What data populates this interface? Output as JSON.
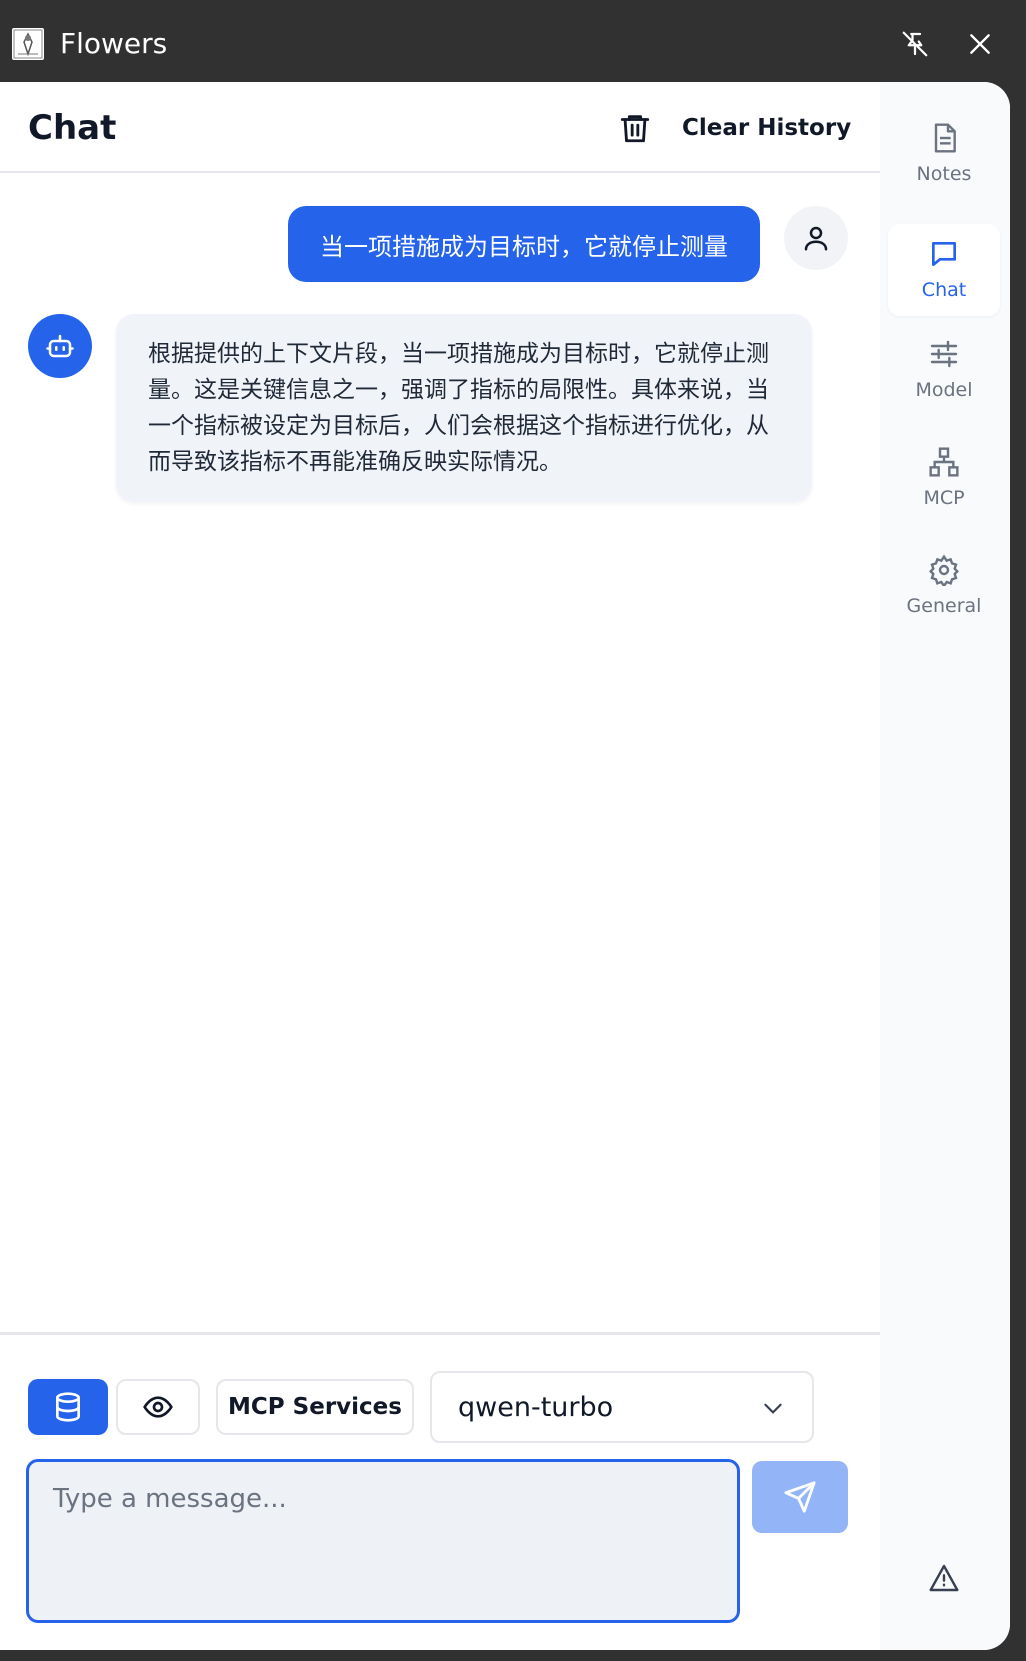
{
  "window": {
    "title": "Flowers"
  },
  "titlebar": {
    "icons": [
      "app-icon",
      "unpin-icon",
      "close-icon"
    ]
  },
  "chat": {
    "title": "Chat",
    "clear_label": "Clear History",
    "messages": [
      {
        "role": "user",
        "text": "当一项措施成为目标时，它就停止测量"
      },
      {
        "role": "assistant",
        "text": "根据提供的上下文片段，当一项措施成为目标时，它就停止测量。这是关键信息之一，强调了指标的局限性。具体来说，当一个指标被设定为目标后，人们会根据这个指标进行优化，从而导致该指标不再能准确反映实际情况。"
      }
    ]
  },
  "input": {
    "mcp_label": "MCP Services",
    "model": "qwen-turbo",
    "placeholder": "Type a message...",
    "value": ""
  },
  "sidebar": {
    "items": [
      {
        "label": "Notes",
        "icon": "notes-icon"
      },
      {
        "label": "Chat",
        "icon": "chat-icon",
        "active": true
      },
      {
        "label": "Model",
        "icon": "sliders-icon"
      },
      {
        "label": "MCP",
        "icon": "network-icon"
      },
      {
        "label": "General",
        "icon": "gear-icon"
      }
    ],
    "bottom_icon": "warning-icon"
  },
  "colors": {
    "accent": "#2563eb",
    "send_disabled": "#93b4f6",
    "titlebar": "#313131",
    "bot_bubble": "#f0f3f8"
  }
}
